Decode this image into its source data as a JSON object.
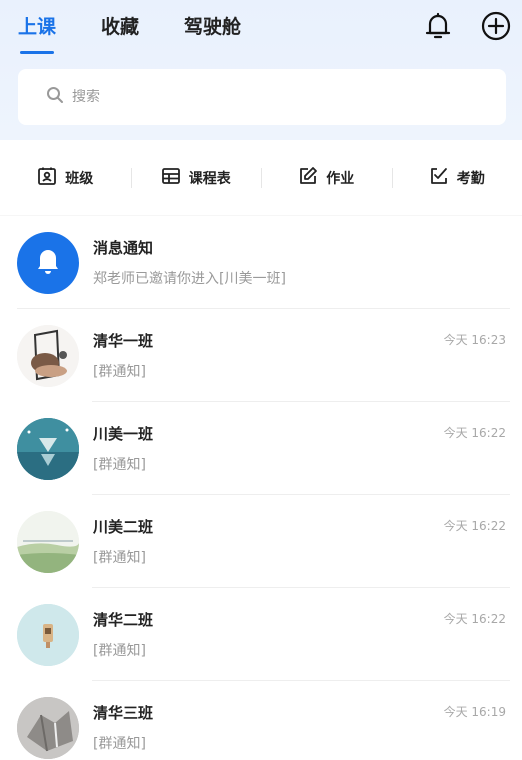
{
  "header": {
    "tabs": [
      {
        "label": "上课",
        "active": true
      },
      {
        "label": "收藏",
        "active": false
      },
      {
        "label": "驾驶舱",
        "active": false
      }
    ],
    "icons": [
      "bell-icon",
      "plus-circle-icon"
    ]
  },
  "search": {
    "placeholder": "搜索"
  },
  "quick_actions": [
    {
      "label": "班级",
      "icon": "class-icon"
    },
    {
      "label": "课程表",
      "icon": "table-icon"
    },
    {
      "label": "作业",
      "icon": "edit-icon"
    },
    {
      "label": "考勤",
      "icon": "checklist-icon"
    }
  ],
  "notice": {
    "title": "消息通知",
    "subtitle": "郑老师已邀请你进入[川美一班]",
    "color": "#1a73e8"
  },
  "classes": [
    {
      "name": "清华一班",
      "tag": "[群通知]",
      "time": "今天 16:23"
    },
    {
      "name": "川美一班",
      "tag": "[群通知]",
      "time": "今天 16:22"
    },
    {
      "name": "川美二班",
      "tag": "[群通知]",
      "time": "今天 16:22"
    },
    {
      "name": "清华二班",
      "tag": "[群通知]",
      "time": "今天 16:22"
    },
    {
      "name": "清华三班",
      "tag": "[群通知]",
      "time": "今天 16:19"
    }
  ]
}
